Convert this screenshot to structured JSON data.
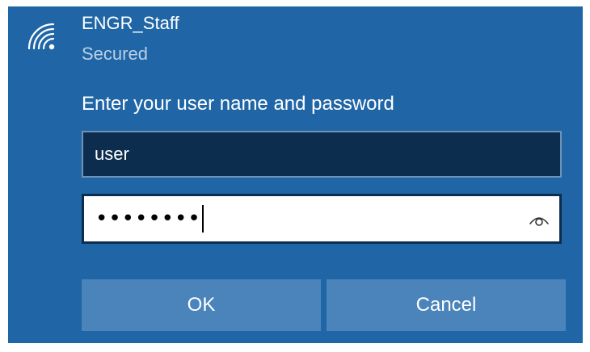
{
  "network": {
    "name": "ENGR_Staff",
    "status": "Secured",
    "icon": "wifi-secured-icon"
  },
  "credentials": {
    "prompt": "Enter your user name and password",
    "username_value": "user",
    "password_masked": "••••••••",
    "password_length": 8,
    "reveal_icon": "eye-icon"
  },
  "buttons": {
    "ok_label": "OK",
    "cancel_label": "Cancel"
  },
  "colors": {
    "panel_background": "#2066a6",
    "username_field_background": "#0c2d4e",
    "password_field_background": "#ffffff",
    "button_background": "#4a84bb",
    "secondary_text": "#b9cfe5"
  }
}
